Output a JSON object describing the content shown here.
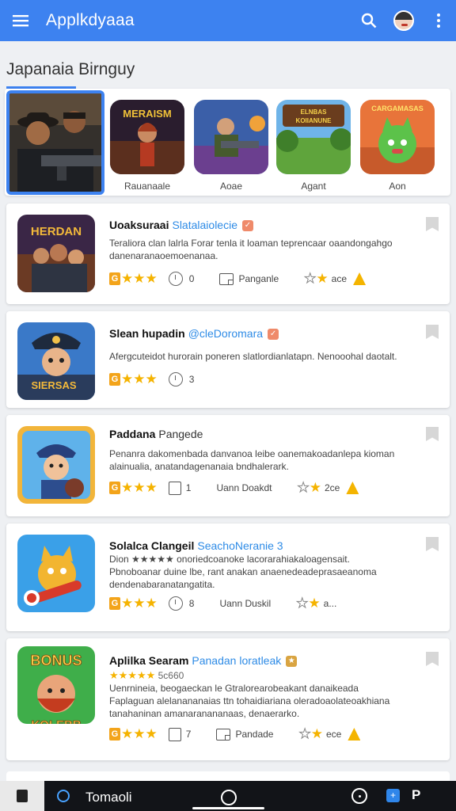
{
  "app_bar": {
    "title": "Applkdyaaa",
    "color": "#3d82f0",
    "icons": [
      "menu-icon",
      "search-icon",
      "avatar",
      "more-vert-icon"
    ]
  },
  "section": {
    "title": "Japanaia Birnguy"
  },
  "featured": [
    {
      "label": ""
    },
    {
      "label": "Rauanaale",
      "art_text": "MERAISM"
    },
    {
      "label": "Aoae"
    },
    {
      "label": "Agant",
      "art_text": "ELNBAS KOIIANUNE"
    },
    {
      "label": "Aon",
      "art_text": "CARGAMASAS"
    }
  ],
  "cards": [
    {
      "name": "Uoaksuraai",
      "dev": "Slatalaiolecie",
      "desc": [
        "Teraliora clan lalrla Forar tenla it loaman teprencaar oaandongahgo",
        "danenaranaoemoenanaa."
      ],
      "rating_badge": "G",
      "stat1": "0",
      "stat2": "Panganle",
      "stat3": "ace",
      "thumb_text": "HERDAN"
    },
    {
      "name": "Slean hupadin",
      "dev": "@cleDoromara",
      "desc": [
        "Afergcuteidot hurorain poneren slatlordianlatapn. Nenooohal daotalt."
      ],
      "rating_badge": "G",
      "stat1": "3",
      "thumb_text": "SIERSAS"
    },
    {
      "name": "Paddana",
      "sub": "Pangede",
      "desc": [
        "Penanra dakomenbada danvanoa leibe oanemakoadanlepa kioman",
        "alainualia, anatandagenanaia bndhalerark."
      ],
      "rating_badge": "G",
      "stat1": "1",
      "stat2": "Uann Doakdt",
      "stat3": "2ce"
    },
    {
      "name": "Solalca Clangeil",
      "dev": "SeachoNeranie 3",
      "small_rating": "Dion",
      "desc": [
        "Dion ★★★★★ onoriedcoanoke lacorarahiakaloagensait.",
        "Pbnoboanar duine lbe, rant anakan anaenedeadeprasaeanoma",
        "dendenabaranatangatita."
      ],
      "rating_badge": "G",
      "stat1": "8",
      "stat2": "Uann Duskil",
      "stat3": "a..."
    },
    {
      "name": "Aplilka Searam",
      "dev": "Panadan loratleak",
      "small_rating": "5c660",
      "desc": [
        "Uenrnineia, beogaeckan le Gtralorearobeakant danaikeada",
        "Faplaguan alelanananaias ttn tohaidiariana oleradoaolateoakhiana",
        "tanahaninan amanaranananaas, denaerarko."
      ],
      "rating_badge": "G",
      "stat1": "7",
      "stat2": "Pandade",
      "stat3": "ece",
      "thumb_text": "BONUS KOLEBB"
    }
  ],
  "navbar": {
    "label": "Tomaoli"
  }
}
